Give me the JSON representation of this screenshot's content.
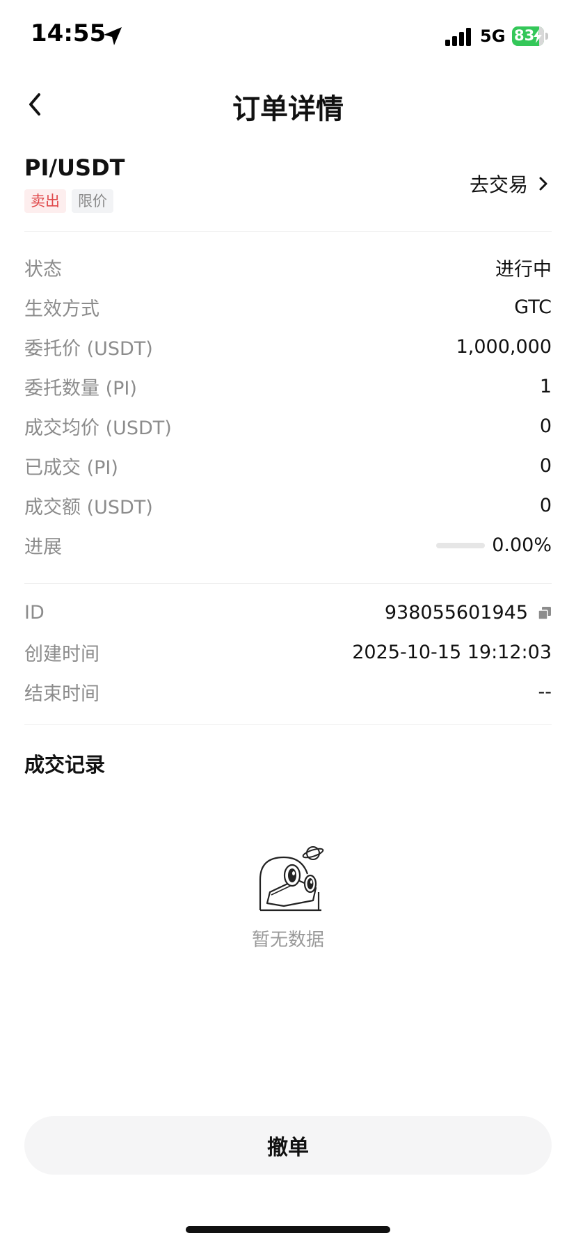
{
  "status_bar": {
    "time": "14:55",
    "network": "5G",
    "battery": "83"
  },
  "nav": {
    "title": "订单详情"
  },
  "order": {
    "pair": "PI/USDT",
    "side_tag": "卖出",
    "type_tag": "限价",
    "trade_link": "去交易"
  },
  "details": [
    {
      "label": "状态",
      "value": "进行中"
    },
    {
      "label": "生效方式",
      "value": "GTC"
    },
    {
      "label": "委托价 (USDT)",
      "value": "1,000,000"
    },
    {
      "label": "委托数量 (PI)",
      "value": "1"
    },
    {
      "label": "成交均价 (USDT)",
      "value": "0"
    },
    {
      "label": "已成交 (PI)",
      "value": "0"
    },
    {
      "label": "成交额 (USDT)",
      "value": "0"
    },
    {
      "label": "进展",
      "value": "0.00%",
      "progress": 0
    }
  ],
  "meta": [
    {
      "label": "ID",
      "value": "938055601945"
    },
    {
      "label": "创建时间",
      "value": "2025-10-15 19:12:03"
    },
    {
      "label": "结束时间",
      "value": "--"
    }
  ],
  "trades": {
    "title": "成交记录",
    "empty_text": "暂无数据"
  },
  "actions": {
    "cancel_label": "撤单"
  },
  "icons": {
    "location": "location-arrow-icon",
    "signal": "cellular-signal-icon",
    "battery": "battery-icon",
    "back": "chevron-left-icon",
    "forward": "chevron-right-icon",
    "copy": "copy-icon",
    "empty": "binoculars-planet-icon"
  },
  "colors": {
    "sell": "#e0494b",
    "battery": "#34c759"
  }
}
